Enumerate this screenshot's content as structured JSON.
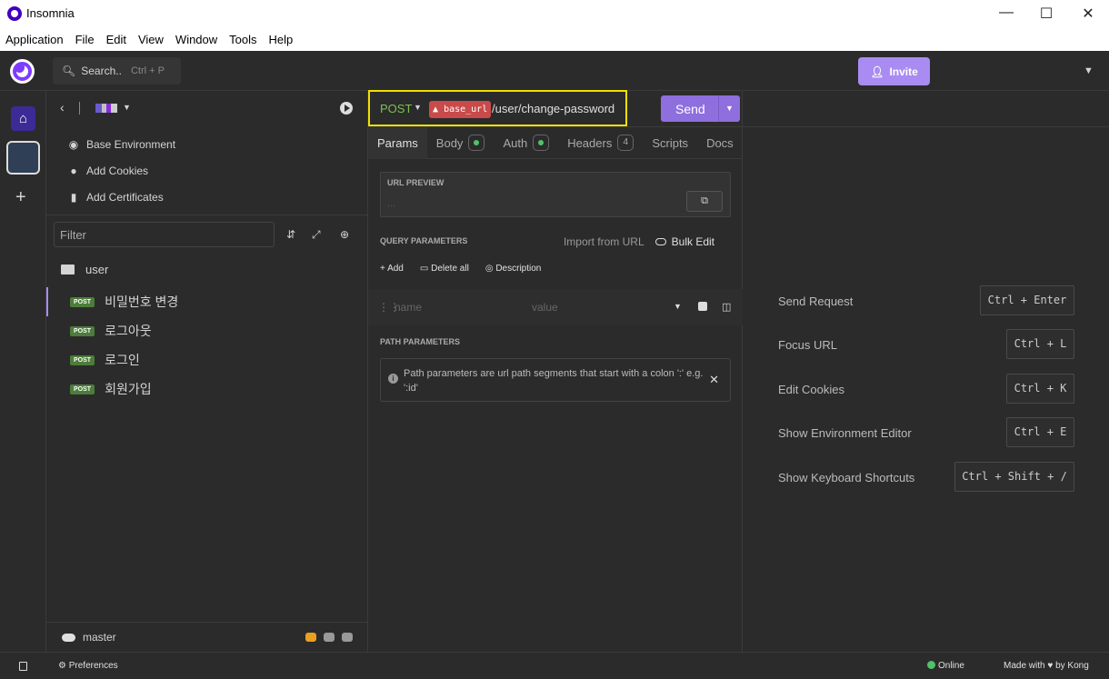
{
  "window": {
    "title": "Insomnia",
    "controls": {
      "minimize": "—",
      "maximize": "☐",
      "close": "✕"
    }
  },
  "menubar": [
    "Application",
    "File",
    "Edit",
    "View",
    "Window",
    "Tools",
    "Help"
  ],
  "topbar": {
    "search_label": "Search..",
    "search_shortcut": "Ctrl + P",
    "invite_label": "Invite",
    "invite_icon": "add-user-icon",
    "accent": "#a98bf2"
  },
  "sidebar": {
    "links": [
      {
        "label": "Base Environment",
        "icon": "globe-icon"
      },
      {
        "label": "Add Cookies",
        "icon": "cookie-icon"
      },
      {
        "label": "Add Certificates",
        "icon": "certificate-icon"
      }
    ],
    "filter_placeholder": "Filter",
    "folder": "user",
    "requests": [
      {
        "method": "POST",
        "name": "비밀번호 변경",
        "active": true
      },
      {
        "method": "POST",
        "name": "로그아웃",
        "active": false
      },
      {
        "method": "POST",
        "name": "로그인",
        "active": false
      },
      {
        "method": "POST",
        "name": "회원가입",
        "active": false
      }
    ],
    "branch": "master"
  },
  "request": {
    "method": "POST",
    "env_var": "base_url",
    "env_var_icon": "warning-icon",
    "path": "/user/change-password",
    "send_label": "Send",
    "method_color": "#7cc04f",
    "var_color": "#c94a4a"
  },
  "tabs": [
    {
      "label": "Params",
      "active": true
    },
    {
      "label": "Body",
      "indicator": "dot"
    },
    {
      "label": "Auth",
      "indicator": "dot"
    },
    {
      "label": "Headers",
      "count": "4"
    },
    {
      "label": "Scripts"
    },
    {
      "label": "Docs"
    }
  ],
  "params": {
    "url_preview_label": "URL PREVIEW",
    "url_preview_value": "...",
    "query_label": "QUERY PARAMETERS",
    "import_label": "Import from URL",
    "bulk_label": "Bulk Edit",
    "add_label": "Add",
    "delete_all_label": "Delete all",
    "description_label": "Description",
    "name_placeholder": "name",
    "value_placeholder": "value",
    "path_label": "PATH PARAMETERS",
    "path_info": "Path parameters are url path segments that start with a colon ':' e.g. ':id'"
  },
  "shortcuts": [
    {
      "label": "Send Request",
      "keys": "Ctrl + Enter"
    },
    {
      "label": "Focus URL",
      "keys": "Ctrl + L"
    },
    {
      "label": "Edit Cookies",
      "keys": "Ctrl + K"
    },
    {
      "label": "Show Environment Editor",
      "keys": "Ctrl + E"
    },
    {
      "label": "Show Keyboard Shortcuts",
      "keys": "Ctrl + Shift + /"
    }
  ],
  "status": {
    "preferences_label": "Preferences",
    "online_label": "Online",
    "made_with_prefix": "Made with",
    "made_with_suffix": "by Kong",
    "online_color": "#4fc26a"
  }
}
